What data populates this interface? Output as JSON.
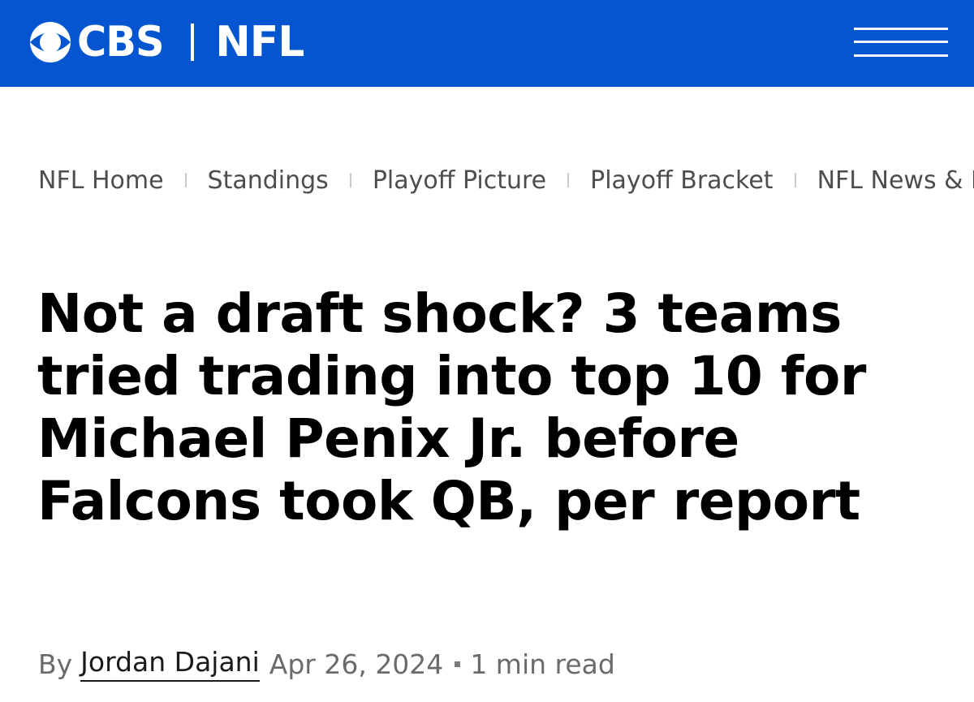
{
  "header": {
    "logo_text": "CBS",
    "section": "NFL",
    "brand_color": "#0455cf",
    "menu_icon": "hamburger-menu-icon"
  },
  "subnav": {
    "items": [
      {
        "label": "NFL Home"
      },
      {
        "label": "Standings"
      },
      {
        "label": "Playoff Picture"
      },
      {
        "label": "Playoff Bracket"
      },
      {
        "label": "NFL News & H"
      }
    ]
  },
  "article": {
    "headline": "Not a draft shock? 3 teams tried trading into top 10 for Michael Penix Jr. before Falcons took QB, per report",
    "byline_prefix": "By",
    "author": "Jordan Dajani",
    "date": "Apr 26, 2024",
    "read_time": "1 min read"
  }
}
